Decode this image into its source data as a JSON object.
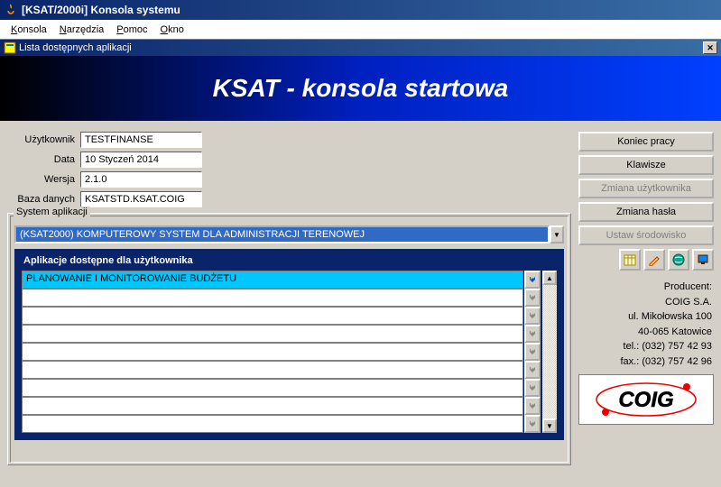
{
  "window": {
    "title": "[KSAT/2000i] Konsola systemu"
  },
  "menu": [
    "Konsola",
    "Narzędzia",
    "Pomoc",
    "Okno"
  ],
  "subwindow": {
    "title": "Lista dostępnych aplikacji"
  },
  "banner": "KSAT - konsola startowa",
  "info": {
    "user_label": "Użytkownik",
    "user_value": "TESTFINANSE",
    "date_label": "Data",
    "date_value": "10 Styczeń    2014",
    "version_label": "Wersja",
    "version_value": "2.1.0",
    "db_label": "Baza danych",
    "db_value": "KSATSTD.KSAT.COIG"
  },
  "system": {
    "group_label": "System aplikacji",
    "selected": "(KSAT2000) KOMPUTEROWY SYSTEM DLA ADMINISTRACJI TERENOWEJ",
    "sub_title": "Aplikacje dostępne dla użytkownika",
    "rows": [
      "PLANOWANIE I MONITOROWANIE BUDŻETU",
      "",
      "",
      "",
      "",
      "",
      "",
      "",
      ""
    ]
  },
  "buttons": {
    "end": "Koniec pracy",
    "keys": "Klawisze",
    "chuser": "Zmiana użytkownika",
    "chpass": "Zmiana hasła",
    "setenv": "Ustaw środowisko"
  },
  "producer": {
    "label": "Producent:",
    "name": "COIG S.A.",
    "street": "ul. Mikołowska 100",
    "city": "40-065 Katowice",
    "tel": "tel.: (032) 757 42 93",
    "fax": "fax.: (032) 757 42 96"
  }
}
